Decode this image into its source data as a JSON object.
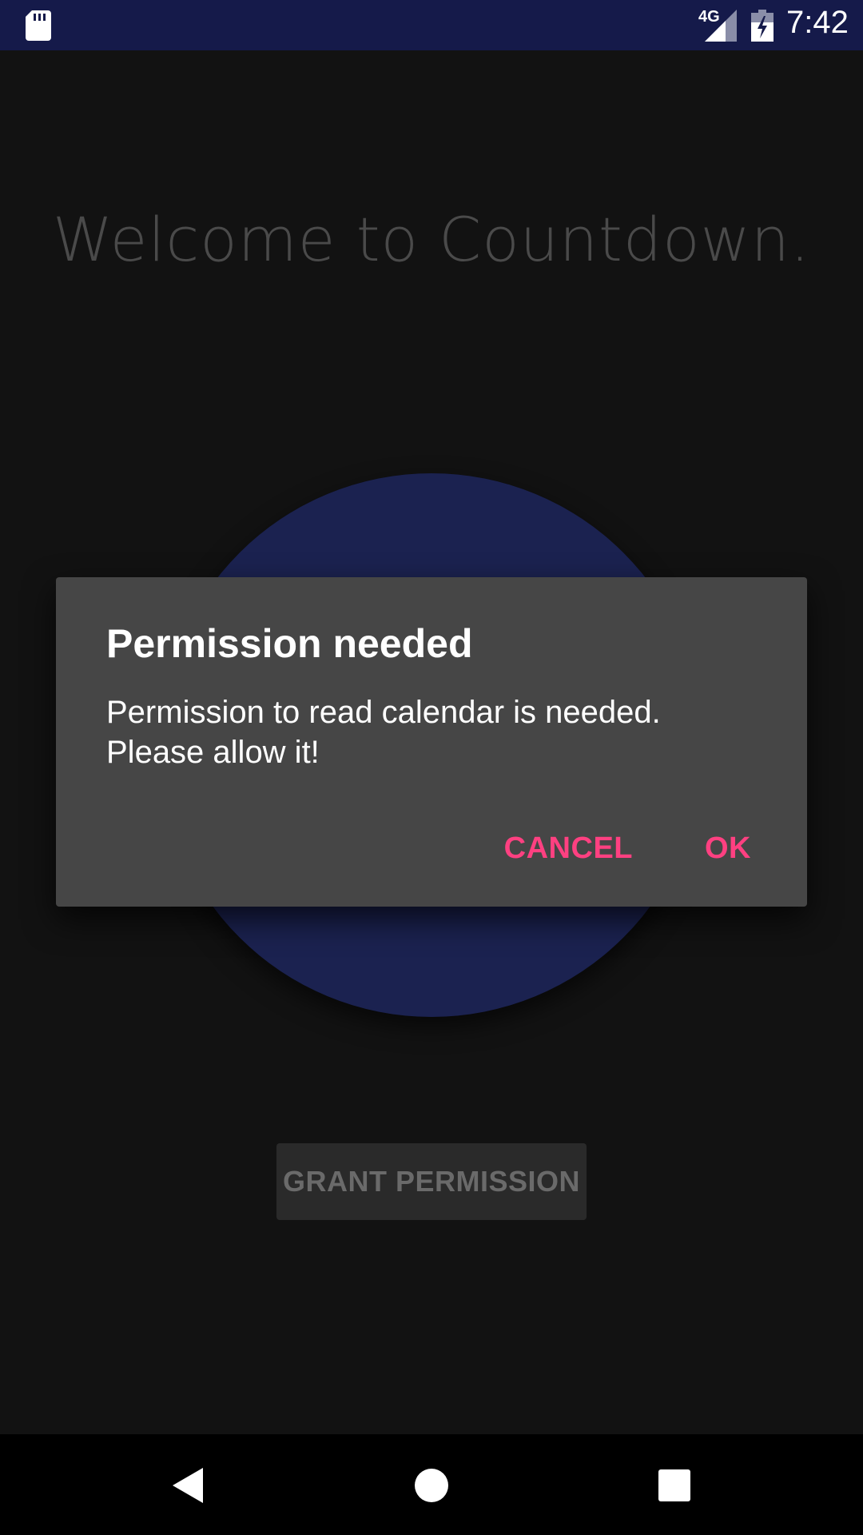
{
  "status_bar": {
    "network": "4G",
    "time": "7:42",
    "icons": [
      "sd-card-icon",
      "signal-icon",
      "battery-charging-icon"
    ],
    "background_color": "#151a4a"
  },
  "main": {
    "welcome_title": "Welcome to Countdown.",
    "grant_button_label": "GRANT PERMISSION",
    "circle_color": "#1b2250"
  },
  "dialog": {
    "title": "Permission needed",
    "message": "Permission to read calendar is needed. Please allow it!",
    "cancel_label": "CANCEL",
    "ok_label": "OK",
    "accent_color": "#ff4081"
  },
  "nav_bar": {
    "icons": [
      "back-icon",
      "home-icon",
      "recents-icon"
    ]
  }
}
